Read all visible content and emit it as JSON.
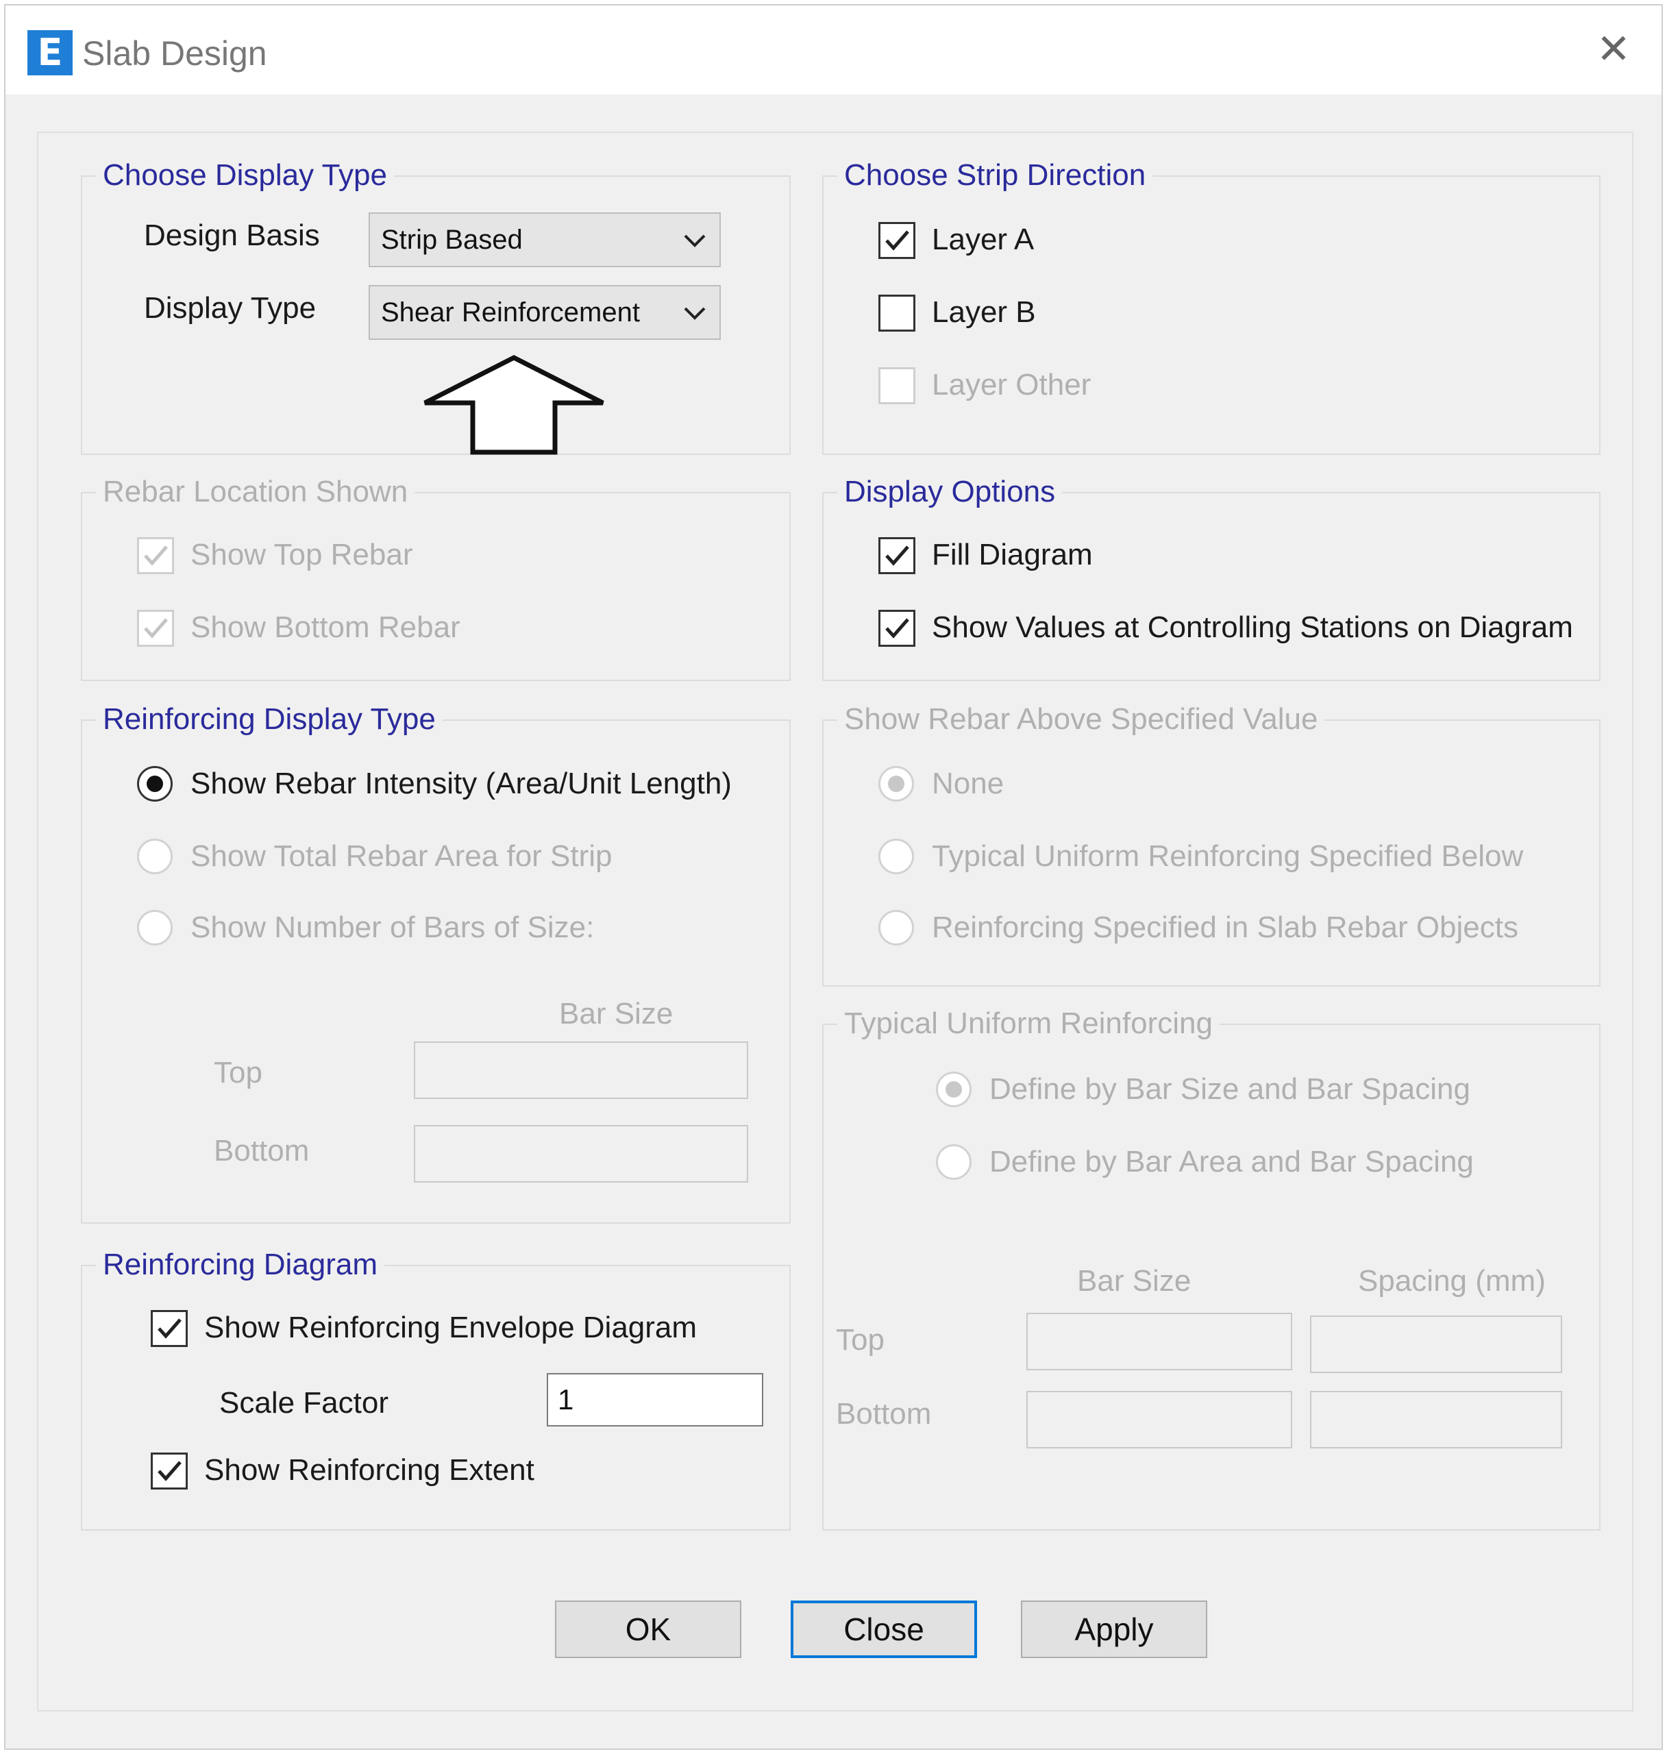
{
  "window": {
    "title": "Slab Design"
  },
  "display_type": {
    "title": "Choose Display Type",
    "design_basis_label": "Design Basis",
    "design_basis_value": "Strip Based",
    "display_type_label": "Display Type",
    "display_type_value": "Shear Reinforcement"
  },
  "strip_direction": {
    "title": "Choose Strip Direction",
    "layer_a": {
      "label": "Layer A",
      "checked": true
    },
    "layer_b": {
      "label": "Layer B",
      "checked": false
    },
    "layer_other": {
      "label": "Layer Other",
      "checked": false
    }
  },
  "rebar_location": {
    "title": "Rebar Location Shown",
    "show_top": {
      "label": "Show Top Rebar",
      "checked": true
    },
    "show_bottom": {
      "label": "Show Bottom Rebar",
      "checked": true
    }
  },
  "display_options": {
    "title": "Display Options",
    "fill_diagram": {
      "label": "Fill Diagram",
      "checked": true
    },
    "show_values": {
      "label": "Show Values at Controlling Stations on Diagram",
      "checked": true
    }
  },
  "reinforcing_display": {
    "title": "Reinforcing Display Type",
    "opt_intensity": "Show Rebar Intensity (Area/Unit Length)",
    "opt_total": "Show Total Rebar Area for Strip",
    "opt_number": "Show Number of Bars of Size:",
    "bar_size_header": "Bar Size",
    "top_label": "Top",
    "bottom_label": "Bottom"
  },
  "rebar_above": {
    "title": "Show Rebar Above Specified Value",
    "opt_none": "None",
    "opt_typical": "Typical Uniform Reinforcing Specified Below",
    "opt_objects": "Reinforcing Specified in Slab Rebar Objects"
  },
  "typical_uniform": {
    "title": "Typical Uniform Reinforcing",
    "opt_bar_size": "Define by Bar Size and Bar Spacing",
    "opt_bar_area": "Define by Bar Area and Bar Spacing",
    "bar_size_header": "Bar Size",
    "spacing_header": "Spacing  (mm)",
    "top_label": "Top",
    "bottom_label": "Bottom"
  },
  "reinforcing_diagram": {
    "title": "Reinforcing Diagram",
    "show_envelope": {
      "label": "Show Reinforcing Envelope Diagram",
      "checked": true
    },
    "scale_factor_label": "Scale Factor",
    "scale_factor_value": "1",
    "show_extent": {
      "label": "Show Reinforcing Extent",
      "checked": true
    }
  },
  "buttons": {
    "ok": "OK",
    "close": "Close",
    "apply": "Apply"
  },
  "icons": {
    "app": "etabs-app-icon",
    "window_close": "close-icon"
  }
}
